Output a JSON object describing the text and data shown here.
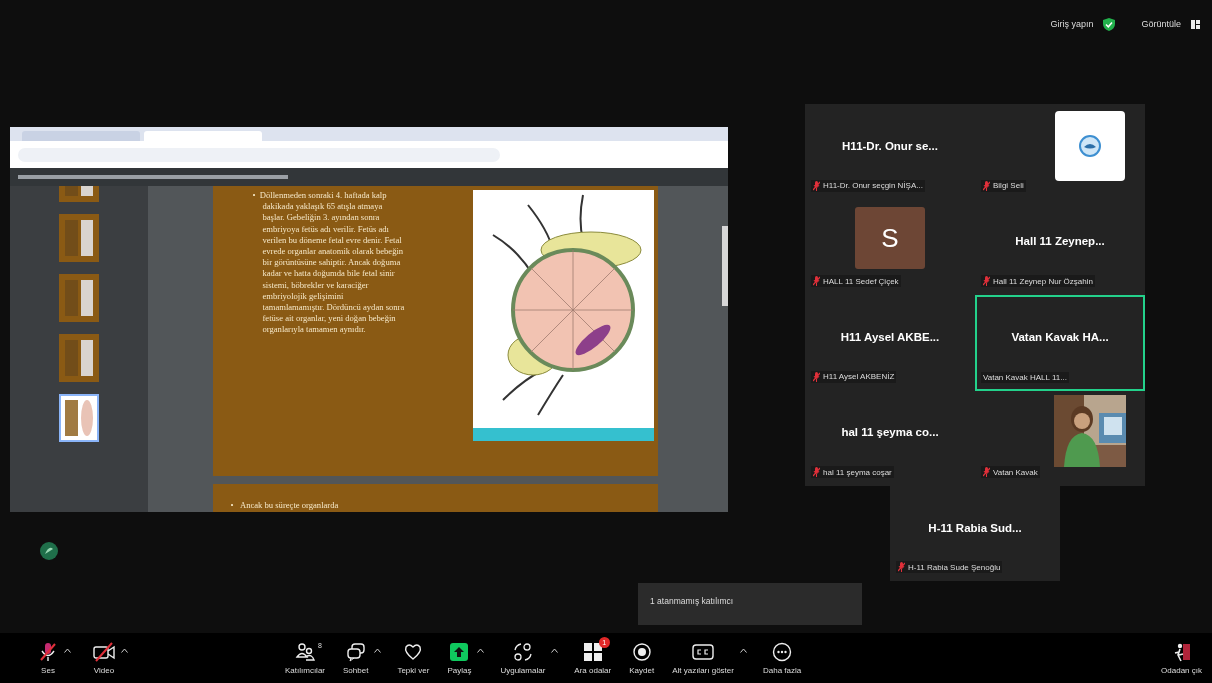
{
  "top_bar": {
    "sign_in": "Giriş yapın",
    "view": "Görüntüle"
  },
  "shared_screen": {
    "slides": [
      {
        "bullet": "•",
        "text": "Döllenmeden sonraki 4. haftada kalp dakikada yaklaşık 65 atışla atmaya başlar. Gebeliğin 3. ayından sonra embriyoya fetüs adı verilir. Fetüs adı verilen bu döneme fetal evre denir. Fetal evrede organlar anatomik olarak bebeğin bir görüntüsüne sahiptir. Ancak doğuma kadar ve hatta doğumda bile fetal sinir sistemi, böbrekler ve karaciğer embriyolojik gelişimini tamamlamamıştır. Dördüncü aydan sonra fetüse ait organlar, yeni doğan bebeğin organlarıyla tamamen aynıdır."
      },
      {
        "bullet": "•",
        "text": "Ancak bu süreçte organlarda"
      }
    ],
    "thumbnails": [
      {
        "selected": false
      },
      {
        "selected": false
      },
      {
        "selected": false
      },
      {
        "selected": false
      },
      {
        "selected": true
      }
    ]
  },
  "participants": [
    {
      "kind": "name",
      "display": "H11-Dr. Onur se...",
      "label": "H11-Dr. Onur seçgin NİŞA...",
      "muted": true,
      "active": false
    },
    {
      "kind": "logo",
      "label": "Bilgi Seli",
      "muted": true,
      "active": false
    },
    {
      "kind": "letter",
      "initial": "S",
      "label": "HALL 11 Sedef Çiçek",
      "muted": true,
      "active": false
    },
    {
      "kind": "name",
      "display": "Hall 11 Zeynep...",
      "label": "Hall 11 Zeynep Nur Özşahin",
      "muted": true,
      "active": false
    },
    {
      "kind": "name",
      "display": "H11 Aysel AKBE...",
      "label": "H11 Aysel AKBENİZ",
      "muted": true,
      "active": false
    },
    {
      "kind": "name",
      "display": "Vatan Kavak HA...",
      "label": "Vatan Kavak HALL 11...",
      "muted": false,
      "active": true
    },
    {
      "kind": "name",
      "display": "hal 11 şeyma co...",
      "label": "hal 11 şeyma coşar",
      "muted": true,
      "active": false
    },
    {
      "kind": "video",
      "label": "Vatan Kavak",
      "muted": true,
      "active": false
    }
  ],
  "overflow_participant": {
    "kind": "name",
    "display": "H-11 Rabia Sud...",
    "label": "H-11 Rabia Sude Şenoğlu",
    "muted": true,
    "active": false
  },
  "tooltip": "1 atanmamış katılımcı",
  "toolbar": [
    {
      "kind": "mic",
      "label": "Ses",
      "off": true,
      "caret": true
    },
    {
      "kind": "camera",
      "label": "Video",
      "off": true,
      "caret": true
    },
    {
      "kind": "people",
      "label": "Katılımcılar",
      "count": "8"
    },
    {
      "kind": "chat",
      "label": "Sohbet",
      "caret": true
    },
    {
      "kind": "heart",
      "label": "Tepki ver"
    },
    {
      "kind": "share",
      "label": "Paylaş",
      "caret": true
    },
    {
      "kind": "apps",
      "label": "Uygulamalar",
      "caret": true
    },
    {
      "kind": "rooms",
      "label": "Ara odalar",
      "badge": "1"
    },
    {
      "kind": "record",
      "label": "Kaydet"
    },
    {
      "kind": "cc",
      "label": "Alt yazıları göster",
      "caret": true
    },
    {
      "kind": "more",
      "label": "Daha fazla"
    },
    {
      "kind": "leave",
      "label": "Odadan çık"
    }
  ]
}
